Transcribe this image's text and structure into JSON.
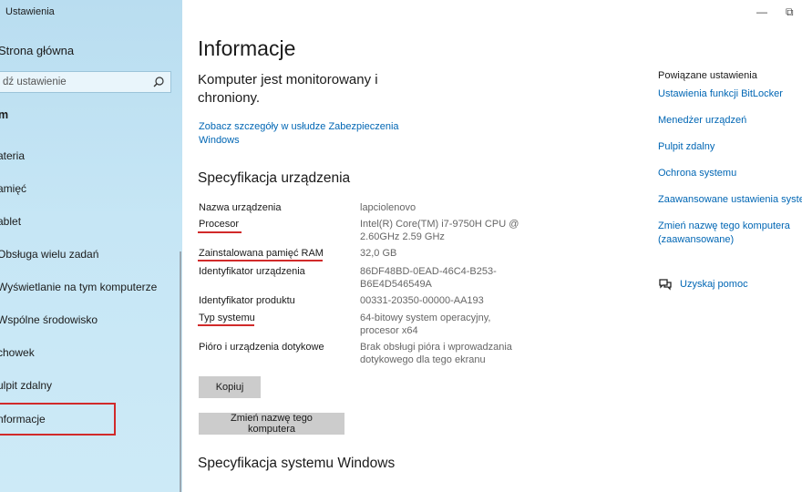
{
  "app_title": "Ustawienia",
  "window_controls": {
    "minimize": "—",
    "restore": "⧉"
  },
  "sidebar": {
    "home_label": "Strona główna",
    "search_placeholder": "dź ustawienie",
    "section_label": "m",
    "items": [
      {
        "label": "ateria"
      },
      {
        "label": "amięć"
      },
      {
        "label": "ablet"
      },
      {
        "label": "Obsługa wielu zadań"
      },
      {
        "label": "Wyświetlanie na tym komputerze"
      },
      {
        "label": "Wspólne środowisko"
      },
      {
        "label": "chowek"
      },
      {
        "label": "ulpit zdalny"
      },
      {
        "label": "nformacje"
      }
    ],
    "selected_item": "nformacje"
  },
  "main": {
    "title": "Informacje",
    "status": "Komputer jest monitorowany i chroniony.",
    "security_link": "Zobacz szczegóły w usłudze Zabezpieczenia Windows",
    "device_spec_heading": "Specyfikacja urządzenia",
    "specs": [
      {
        "label": "Nazwa urządzenia",
        "value": "lapciolenovo"
      },
      {
        "label": "Procesor",
        "value": "Intel(R) Core(TM) i7-9750H CPU @ 2.60GHz   2.59 GHz"
      },
      {
        "label": "Zainstalowana pamięć RAM",
        "value": "32,0 GB"
      },
      {
        "label": "Identyfikator urządzenia",
        "value": "86DF48BD-0EAD-46C4-B253-B6E4D546549A"
      },
      {
        "label": "Identyfikator produktu",
        "value": "00331-20350-00000-AA193"
      },
      {
        "label": "Typ systemu",
        "value": "64-bitowy system operacyjny, procesor x64"
      },
      {
        "label": "Pióro i urządzenia dotykowe",
        "value": "Brak obsługi pióra i wprowadzania dotykowego dla tego ekranu"
      }
    ],
    "copy_button": "Kopiuj",
    "rename_button": "Zmień nazwę tego komputera",
    "windows_spec_heading": "Specyfikacja systemu Windows"
  },
  "related": {
    "title": "Powiązane ustawienia",
    "links": [
      "Ustawienia funkcji BitLocker",
      "Menedżer urządzeń",
      "Pulpit zdalny",
      "Ochrona systemu",
      "Zaawansowane ustawienia systemu",
      "Zmień nazwę tego komputera (zaawansowane)"
    ],
    "help": "Uzyskaj pomoc"
  },
  "colors": {
    "accent": "#0066b4",
    "highlight": "#d12a2a",
    "sidebar_bg": "#c6e6f5"
  }
}
